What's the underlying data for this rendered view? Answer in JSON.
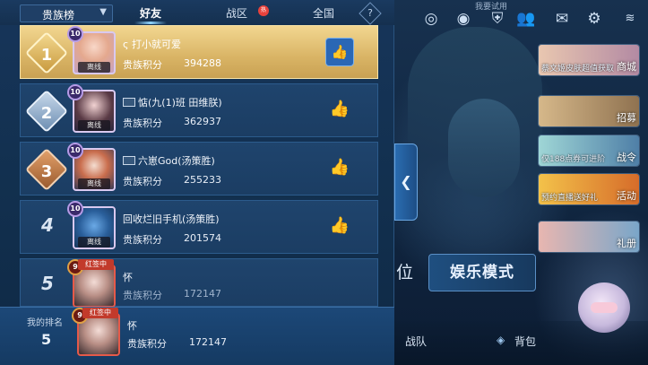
{
  "tabs": {
    "dropdown_label": "贵族榜",
    "friends": "好友",
    "region": "战区",
    "region_badge": "热",
    "global": "全国",
    "help": "?"
  },
  "rows": [
    {
      "rank": "1",
      "level": "10",
      "status": "离线",
      "name": "ς 打小就可爱",
      "score_label": "贵族积分",
      "score": "394288"
    },
    {
      "rank": "2",
      "level": "10",
      "status": "离线",
      "name": "惦(九(1)班  田维朕)",
      "score_label": "贵族积分",
      "score": "362937"
    },
    {
      "rank": "3",
      "level": "10",
      "status": "离线",
      "name": "六崽God(汤策胜)",
      "score_label": "贵族积分",
      "score": "255233"
    },
    {
      "rank": "4",
      "level": "10",
      "status": "离线",
      "name": "回收烂旧手机(汤策胜)",
      "score_label": "贵族积分",
      "score": "201574"
    },
    {
      "rank": "5",
      "level": "9",
      "status": "红签中",
      "name": "怀",
      "score_label": "贵族积分",
      "score": "172147"
    }
  ],
  "my_rank": {
    "label": "我的排名",
    "rank": "5",
    "level": "9",
    "status": "红签中",
    "name": "怀",
    "score_label": "贵族积分",
    "score": "172147"
  },
  "game_ui": {
    "top_tiny": "我要试用",
    "cards": [
      {
        "caption": "蔡文姬皮肤超值获取",
        "tag": "商城"
      },
      {
        "caption": "",
        "tag": "招募"
      },
      {
        "caption": "仅188点券可进阶",
        "tag": "战令"
      },
      {
        "caption": "预约直播送好礼",
        "tag": "活动"
      },
      {
        "caption": "",
        "tag": "礼册"
      }
    ],
    "mode_left": "位",
    "mode_button": "娱乐模式",
    "bottom_team": "战队",
    "bottom_bag": "背包"
  },
  "colors": {
    "first_row": "#e0bc6e",
    "row": "#1e426a",
    "like": "#1b5da8",
    "live_badge": "#c23a2b"
  }
}
